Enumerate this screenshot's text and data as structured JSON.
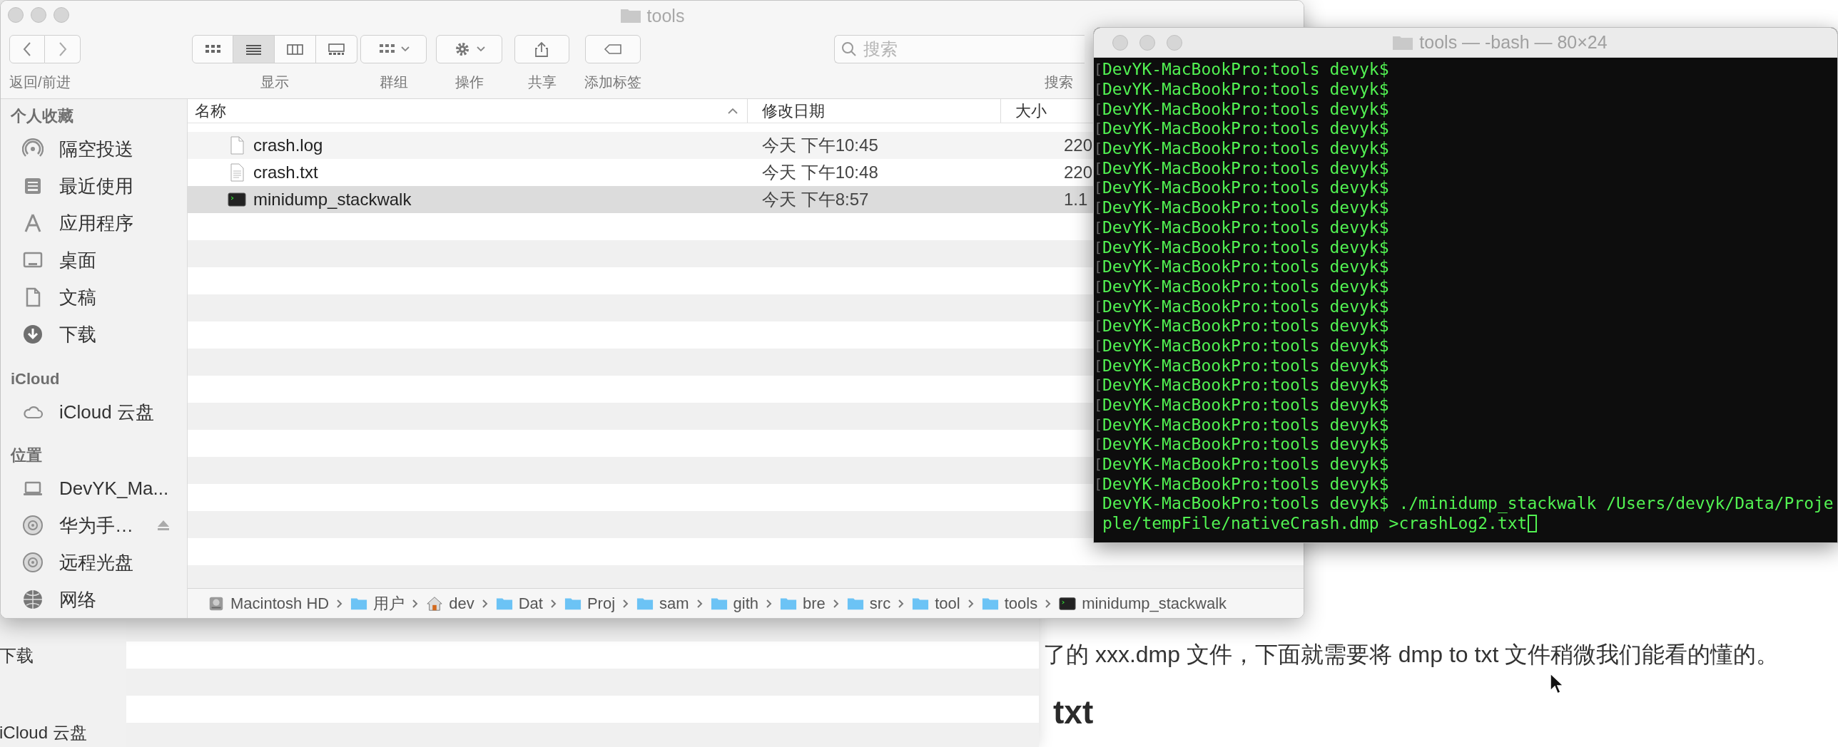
{
  "background_window": {
    "sidebar_items": [
      "下载",
      "iCloud 云盘"
    ]
  },
  "article": {
    "paragraph": "了的 xxx.dmp 文件，下面就需要将 dmp to txt 文件稍微我们能看的懂的。",
    "heading": "txt"
  },
  "finder": {
    "title": "tools",
    "toolbar": {
      "nav_label": "返回/前进",
      "view": {
        "label": "显示",
        "modes": [
          {
            "kind": "icons",
            "selected": false
          },
          {
            "kind": "list",
            "selected": true
          },
          {
            "kind": "columns",
            "selected": false
          },
          {
            "kind": "gallery",
            "selected": false
          }
        ]
      },
      "buttons": [
        {
          "kind": "group",
          "label": "群组"
        },
        {
          "kind": "action",
          "label": "操作"
        },
        {
          "kind": "share",
          "label": "共享"
        },
        {
          "kind": "tag",
          "label": "添加标签"
        }
      ],
      "search": {
        "placeholder": "搜索",
        "label": "搜索"
      }
    },
    "sidebar": [
      {
        "title": "个人收藏",
        "items": [
          {
            "kind": "airdrop",
            "label": "隔空投送"
          },
          {
            "kind": "recent",
            "label": "最近使用"
          },
          {
            "kind": "apps",
            "label": "应用程序"
          },
          {
            "kind": "desktop",
            "label": "桌面"
          },
          {
            "kind": "docs",
            "label": "文稿"
          },
          {
            "kind": "downloads",
            "label": "下载"
          }
        ]
      },
      {
        "title": "iCloud",
        "items": [
          {
            "kind": "cloud",
            "label": "iCloud 云盘"
          }
        ]
      },
      {
        "title": "位置",
        "items": [
          {
            "kind": "laptop",
            "label": "DevYK_Ma..."
          },
          {
            "kind": "disc",
            "label": "华为手…",
            "ejectable": true
          },
          {
            "kind": "disc",
            "label": "远程光盘"
          },
          {
            "kind": "network",
            "label": "网络"
          }
        ]
      }
    ],
    "columns": [
      {
        "label": "名称",
        "sorted": true
      },
      {
        "label": "修改日期",
        "sorted": false
      },
      {
        "label": "大小",
        "sorted": false
      }
    ],
    "files": [
      {
        "kind": "doc",
        "name": "crash.log",
        "date": "今天 下午10:45",
        "size": "220",
        "selected": false
      },
      {
        "kind": "text",
        "name": "crash.txt",
        "date": "今天 下午10:48",
        "size": "220",
        "selected": false
      },
      {
        "kind": "exec",
        "name": "minidump_stackwalk",
        "date": "今天 下午8:57",
        "size": "1.1",
        "selected": true
      }
    ],
    "path": [
      {
        "kind": "disk",
        "label": "Macintosh HD"
      },
      {
        "kind": "folder",
        "label": "用户"
      },
      {
        "kind": "home",
        "label": "dev"
      },
      {
        "kind": "folder",
        "label": "Dat"
      },
      {
        "kind": "folder",
        "label": "Proj"
      },
      {
        "kind": "folder",
        "label": "sam"
      },
      {
        "kind": "folder",
        "label": "gith"
      },
      {
        "kind": "folder",
        "label": "bre"
      },
      {
        "kind": "folder",
        "label": "src"
      },
      {
        "kind": "folder",
        "label": "tool"
      },
      {
        "kind": "folder",
        "label": "tools"
      },
      {
        "kind": "exec",
        "label": "minidump_stackwalk"
      }
    ]
  },
  "terminal": {
    "title": "tools — -bash — 80×24",
    "lines": [
      {
        "mark": "[",
        "text": "DevYK-MacBookPro:tools devyk$"
      },
      {
        "mark": "[",
        "text": "DevYK-MacBookPro:tools devyk$"
      },
      {
        "mark": "[",
        "text": "DevYK-MacBookPro:tools devyk$"
      },
      {
        "mark": "[",
        "text": "DevYK-MacBookPro:tools devyk$"
      },
      {
        "mark": "[",
        "text": "DevYK-MacBookPro:tools devyk$"
      },
      {
        "mark": "[",
        "text": "DevYK-MacBookPro:tools devyk$"
      },
      {
        "mark": "[",
        "text": "DevYK-MacBookPro:tools devyk$"
      },
      {
        "mark": "[",
        "text": "DevYK-MacBookPro:tools devyk$"
      },
      {
        "mark": "[",
        "text": "DevYK-MacBookPro:tools devyk$"
      },
      {
        "mark": "[",
        "text": "DevYK-MacBookPro:tools devyk$"
      },
      {
        "mark": "[",
        "text": "DevYK-MacBookPro:tools devyk$"
      },
      {
        "mark": "[",
        "text": "DevYK-MacBookPro:tools devyk$"
      },
      {
        "mark": "[",
        "text": "DevYK-MacBookPro:tools devyk$"
      },
      {
        "mark": "[",
        "text": "DevYK-MacBookPro:tools devyk$"
      },
      {
        "mark": "[",
        "text": "DevYK-MacBookPro:tools devyk$"
      },
      {
        "mark": "[",
        "text": "DevYK-MacBookPro:tools devyk$"
      },
      {
        "mark": "[",
        "text": "DevYK-MacBookPro:tools devyk$"
      },
      {
        "mark": "[",
        "text": "DevYK-MacBookPro:tools devyk$"
      },
      {
        "mark": "[",
        "text": "DevYK-MacBookPro:tools devyk$"
      },
      {
        "mark": "[",
        "text": "DevYK-MacBookPro:tools devyk$"
      },
      {
        "mark": "[",
        "text": "DevYK-MacBookPro:tools devyk$"
      },
      {
        "mark": "[",
        "text": "DevYK-MacBookPro:tools devyk$"
      },
      {
        "text": "DevYK-MacBookPro:tools devyk$ ./minidump_stackwalk /Users/devyk/Data/Proje"
      },
      {
        "text": "ple/tempFile/nativeCrash.dmp >crashLog2.txt",
        "cursor": true
      }
    ]
  }
}
